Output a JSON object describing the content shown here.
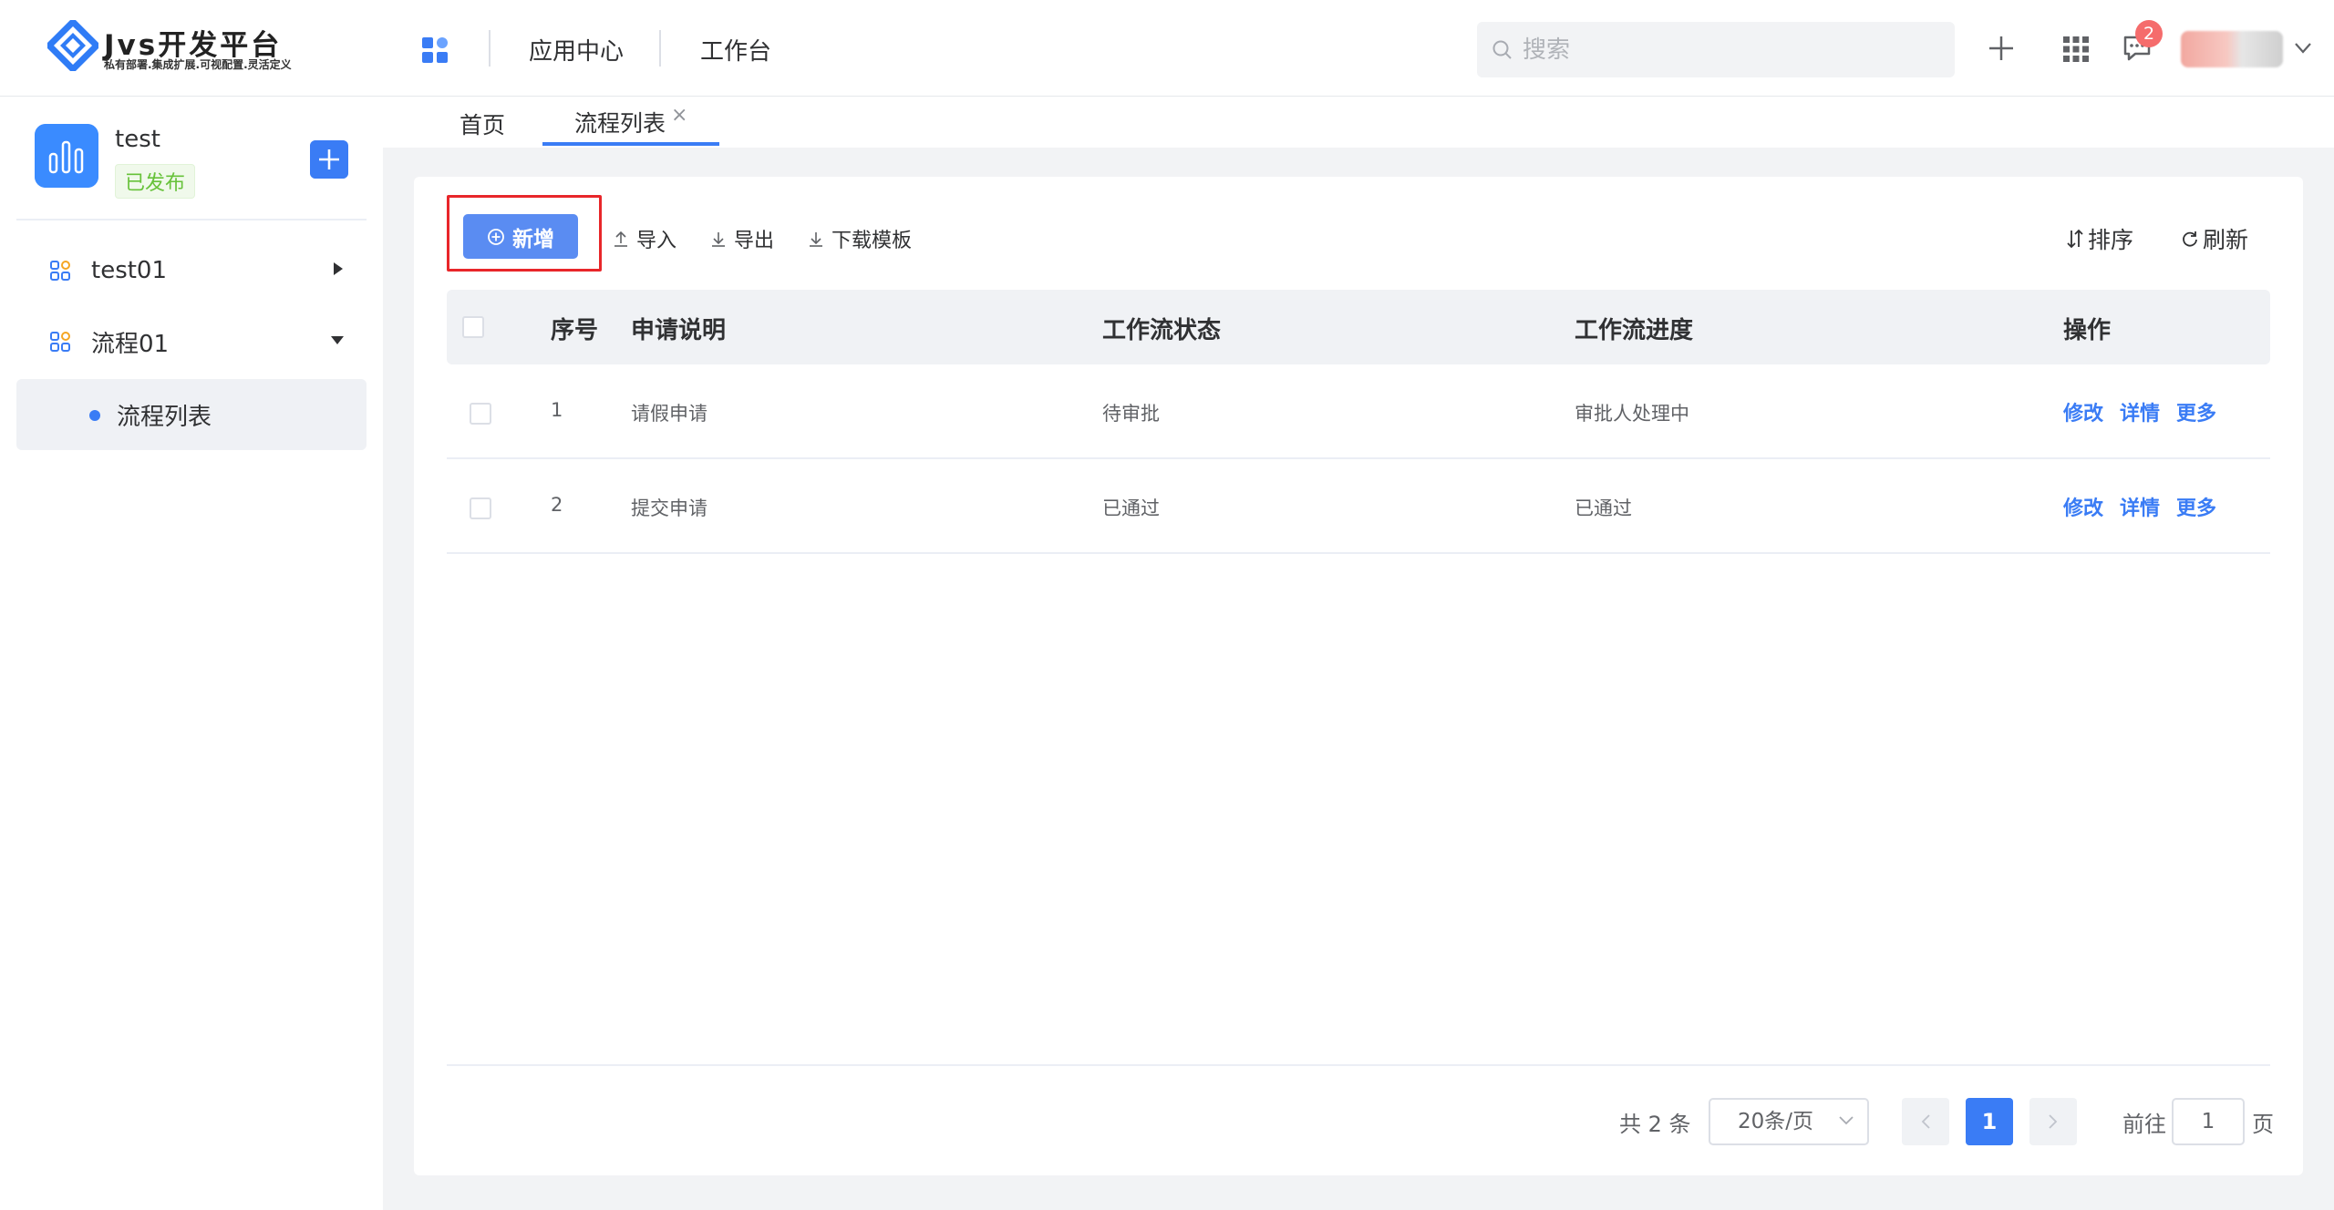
{
  "header": {
    "logo_title": "Jvs开发平台",
    "logo_subtitle": "私有部署.集成扩展.可视配置.灵活定义",
    "nav": [
      "应用中心",
      "工作台"
    ],
    "search_placeholder": "搜索",
    "notification_count": "2",
    "icons": [
      "apps-icon",
      "plus-icon",
      "grid-icon",
      "message-icon",
      "avatar",
      "chevron-down-icon"
    ]
  },
  "sidebar": {
    "app_name": "test",
    "app_status": "已发布",
    "menu": [
      {
        "label": "test01",
        "expanded": false
      },
      {
        "label": "流程01",
        "expanded": true
      },
      {
        "label": "流程列表",
        "active": true
      }
    ]
  },
  "tabs": [
    {
      "label": "首页"
    },
    {
      "label": "流程列表",
      "active": true,
      "closable": true
    }
  ],
  "toolbar": {
    "new_label": "新增",
    "import_label": "导入",
    "export_label": "导出",
    "template_label": "下载模板",
    "sort_label": "排序",
    "refresh_label": "刷新"
  },
  "table": {
    "columns": [
      "序号",
      "申请说明",
      "工作流状态",
      "工作流进度",
      "操作"
    ],
    "rows": [
      {
        "index": "1",
        "desc": "请假申请",
        "status": "待审批",
        "progress": "审批人处理中"
      },
      {
        "index": "2",
        "desc": "提交申请",
        "status": "已通过",
        "progress": "已通过"
      }
    ],
    "actions": [
      "修改",
      "详情",
      "更多"
    ]
  },
  "pagination": {
    "total_text": "共 2 条",
    "page_size": "20条/页",
    "current_page": "1",
    "goto_prefix": "前往",
    "goto_value": "1",
    "goto_suffix": "页"
  },
  "colors": {
    "primary": "#3a7cf5",
    "highlight": "#e8262a",
    "badge": "#f56c6c",
    "status_green": "#67c23a"
  }
}
